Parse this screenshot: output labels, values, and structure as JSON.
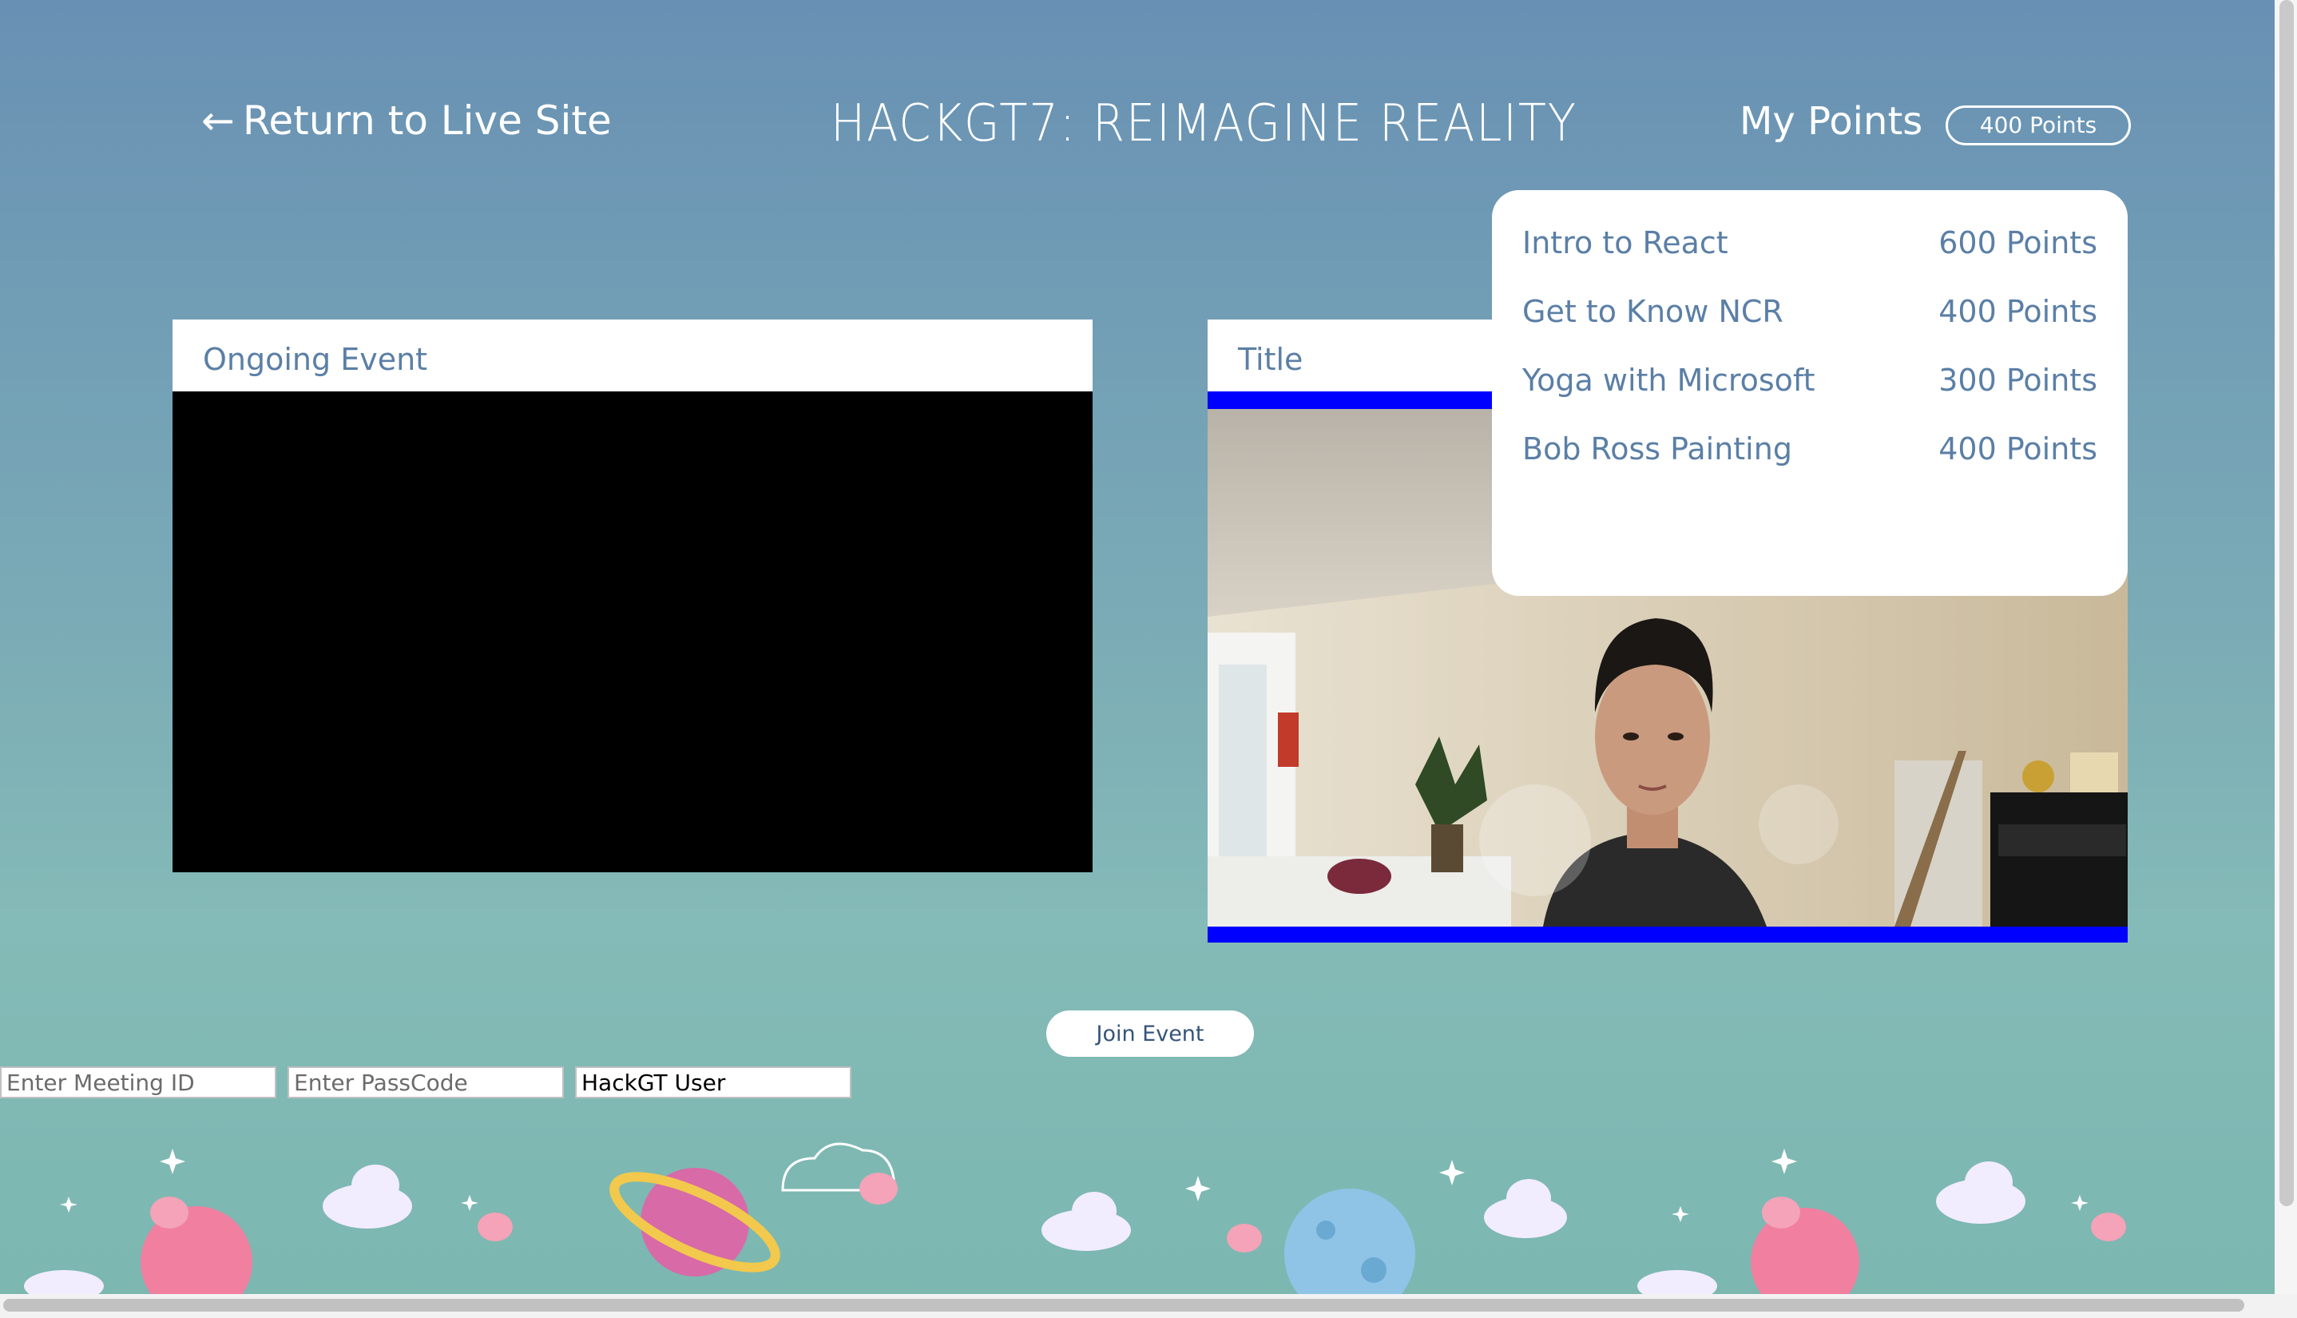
{
  "header": {
    "return_arrow": "←",
    "return_label": "Return to Live Site",
    "site_title": "HACKGT7: REIMAGINE REALITY",
    "my_points_label": "My Points",
    "points_badge": "400 Points"
  },
  "ongoing_event": {
    "title": "Ongoing Event"
  },
  "camera_panel": {
    "title": "Title"
  },
  "points_dropdown": {
    "items": [
      {
        "name": "Intro to React",
        "points": "600 Points"
      },
      {
        "name": "Get to Know NCR",
        "points": "400 Points"
      },
      {
        "name": "Yoga with Microsoft",
        "points": "300 Points"
      },
      {
        "name": "Bob Ross Painting",
        "points": "400 Points"
      }
    ]
  },
  "join": {
    "button_label": "Join Event",
    "meeting_id_placeholder": "Enter Meeting ID",
    "passcode_placeholder": "Enter PassCode",
    "username_value": "HackGT User"
  },
  "colors": {
    "accent_text": "#5b7fa6",
    "video_border": "#0000ff"
  },
  "icons": [
    "left-arrow-icon"
  ]
}
